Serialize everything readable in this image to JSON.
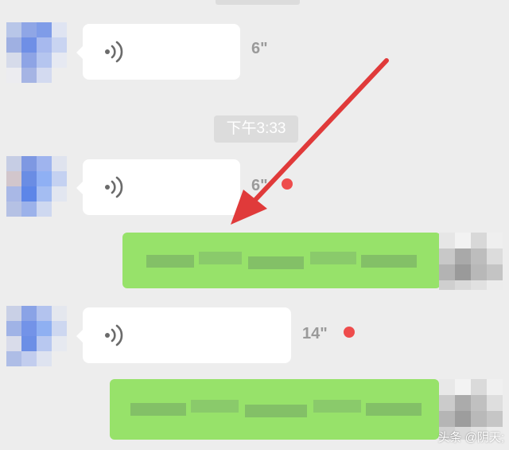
{
  "messages": [
    {
      "duration": "6\"",
      "unread": false
    },
    {
      "duration": "6\"",
      "unread": true
    },
    {
      "duration": "14\"",
      "unread": true
    }
  ],
  "timestamp": "下午3:33",
  "watermark": "头条 @阴天;",
  "colors": {
    "background": "#ededed",
    "bubble": "#ffffff",
    "outgoing": "#97e26a",
    "unread_dot": "#ee4c4c",
    "arrow": "#e03a3a",
    "time_pill": "#dcdcdc"
  },
  "icons": {
    "voice": "sound-wave-icon",
    "annotation": "red-arrow"
  }
}
